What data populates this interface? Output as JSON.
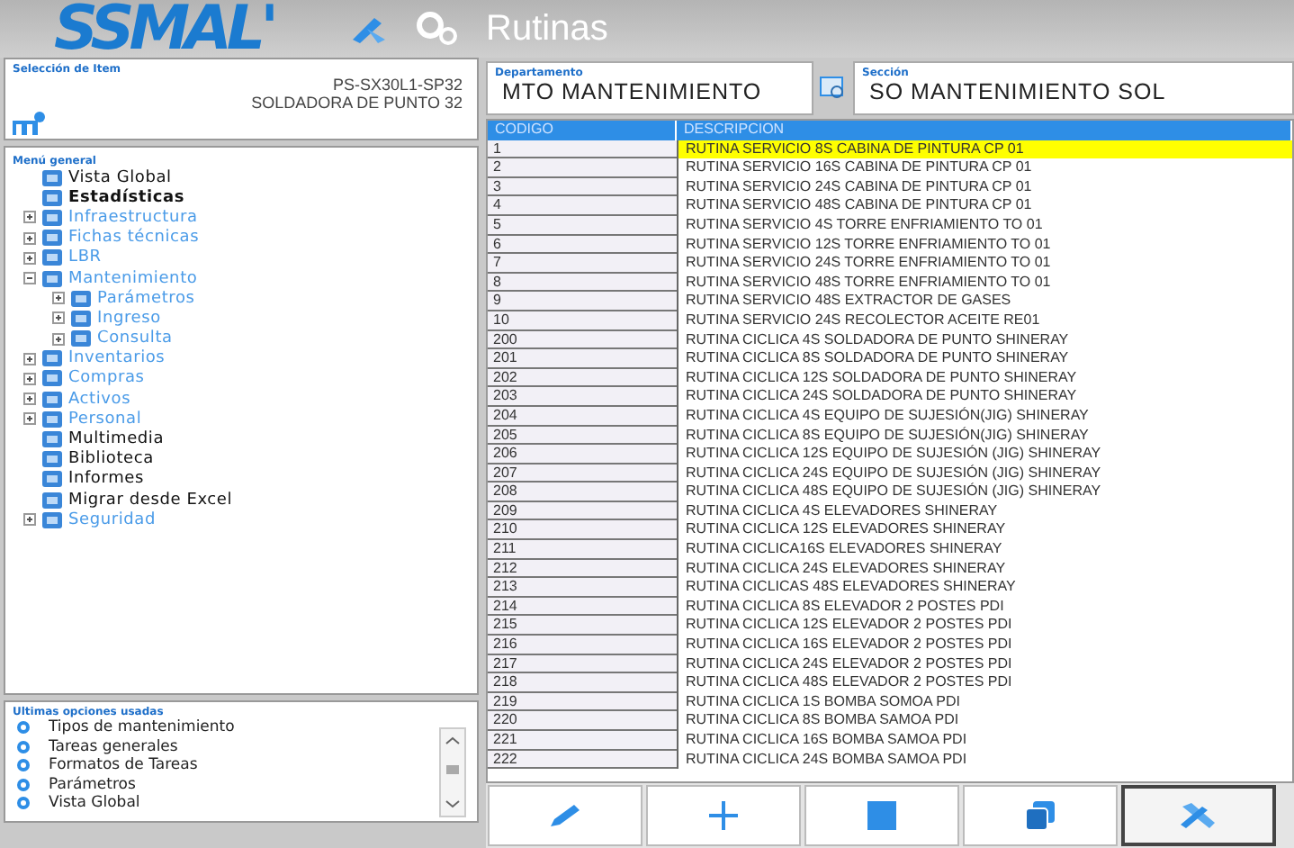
{
  "header": {
    "logo": "SSMAL'",
    "title": "Rutinas"
  },
  "selection": {
    "label": "Selección de Item",
    "code": "PS-SX30L1-SP32",
    "name": "SOLDADORA DE PUNTO 32"
  },
  "menu": {
    "label": "Menú general",
    "items": [
      {
        "label": "Vista Global",
        "kind": "plain"
      },
      {
        "label": "Estadísticas",
        "kind": "bold"
      },
      {
        "label": "Infraestructura",
        "kind": "link",
        "expanded": false
      },
      {
        "label": "Fichas técnicas",
        "kind": "link",
        "expanded": false
      },
      {
        "label": "LBR",
        "kind": "link",
        "expanded": false
      },
      {
        "label": "Mantenimiento",
        "kind": "link",
        "expanded": true,
        "children": [
          {
            "label": "Parámetros",
            "kind": "link",
            "expanded": false
          },
          {
            "label": "Ingreso",
            "kind": "link",
            "expanded": false
          },
          {
            "label": "Consulta",
            "kind": "link",
            "expanded": false
          }
        ]
      },
      {
        "label": "Inventarios",
        "kind": "link",
        "expanded": false
      },
      {
        "label": "Compras",
        "kind": "link",
        "expanded": false
      },
      {
        "label": "Activos",
        "kind": "link",
        "expanded": false
      },
      {
        "label": "Personal",
        "kind": "link",
        "expanded": false
      },
      {
        "label": "Multimedia",
        "kind": "plain"
      },
      {
        "label": "Biblioteca",
        "kind": "plain"
      },
      {
        "label": "Informes",
        "kind": "plain"
      },
      {
        "label": "Migrar desde Excel",
        "kind": "plain"
      },
      {
        "label": "Seguridad",
        "kind": "link",
        "expanded": false
      }
    ]
  },
  "recent": {
    "label": "Ultimas opciones usadas",
    "items": [
      "Tipos de mantenimiento",
      "Tareas generales",
      "Formatos de Tareas",
      "Parámetros",
      "Vista Global"
    ]
  },
  "department": {
    "label": "Departamento",
    "value": "MTO MANTENIMIENTO"
  },
  "section": {
    "label": "Sección",
    "value": "SO MANTENIMIENTO SOL"
  },
  "table": {
    "columns": [
      "CODIGO",
      "DESCRIPCION"
    ],
    "rows": [
      {
        "code": "1",
        "description": "RUTINA SERVICIO 8S CABINA DE PINTURA CP 01",
        "selected": true
      },
      {
        "code": "2",
        "description": "RUTINA SERVICIO 16S CABINA DE PINTURA CP 01",
        "selected": false
      },
      {
        "code": "3",
        "description": "RUTINA SERVICIO 24S CABINA DE PINTURA CP 01",
        "selected": false
      },
      {
        "code": "4",
        "description": "RUTINA SERVICIO 48S CABINA DE PINTURA CP 01",
        "selected": false
      },
      {
        "code": "5",
        "description": "RUTINA SERVICIO 4S TORRE ENFRIAMIENTO TO 01",
        "selected": false
      },
      {
        "code": "6",
        "description": "RUTINA SERVICIO 12S TORRE ENFRIAMIENTO TO 01",
        "selected": false
      },
      {
        "code": "7",
        "description": "RUTINA SERVICIO 24S TORRE ENFRIAMIENTO TO 01",
        "selected": false
      },
      {
        "code": "8",
        "description": "RUTINA SERVICIO 48S TORRE ENFRIAMIENTO TO 01",
        "selected": false
      },
      {
        "code": "9",
        "description": "RUTINA SERVICIO 48S EXTRACTOR DE GASES",
        "selected": false
      },
      {
        "code": "10",
        "description": "RUTINA SERVICIO 24S RECOLECTOR ACEITE RE01",
        "selected": false
      },
      {
        "code": "200",
        "description": "RUTINA CICLICA 4S SOLDADORA DE PUNTO SHINERAY",
        "selected": false
      },
      {
        "code": "201",
        "description": "RUTINA CICLICA 8S SOLDADORA DE PUNTO SHINERAY",
        "selected": false
      },
      {
        "code": "202",
        "description": "RUTINA CICLICA 12S SOLDADORA DE PUNTO SHINERAY",
        "selected": false
      },
      {
        "code": "203",
        "description": "RUTINA CICLICA 24S SOLDADORA DE PUNTO SHINERAY",
        "selected": false
      },
      {
        "code": "204",
        "description": "RUTINA CICLICA 4S EQUIPO DE SUJESIÓN(JIG) SHINERAY",
        "selected": false
      },
      {
        "code": "205",
        "description": "RUTINA CICLICA 8S EQUIPO DE SUJESIÓN(JIG) SHINERAY",
        "selected": false
      },
      {
        "code": "206",
        "description": "RUTINA CICLICA 12S EQUIPO DE SUJESIÓN (JIG) SHINERAY",
        "selected": false
      },
      {
        "code": "207",
        "description": "RUTINA CICLICA 24S EQUIPO DE SUJESIÓN (JIG) SHINERAY",
        "selected": false
      },
      {
        "code": "208",
        "description": "RUTINA CICLICA 48S EQUIPO DE SUJESIÓN (JIG) SHINERAY",
        "selected": false
      },
      {
        "code": "209",
        "description": "RUTINA CICLICA 4S ELEVADORES SHINERAY",
        "selected": false
      },
      {
        "code": "210",
        "description": "RUTINA CICLICA 12S ELEVADORES SHINERAY",
        "selected": false
      },
      {
        "code": "211",
        "description": "RUTINA CICLICA16S ELEVADORES SHINERAY",
        "selected": false
      },
      {
        "code": "212",
        "description": "RUTINA CICLICA 24S ELEVADORES SHINERAY",
        "selected": false
      },
      {
        "code": "213",
        "description": "RUTINA CICLICAS 48S ELEVADORES SHINERAY",
        "selected": false
      },
      {
        "code": "214",
        "description": "RUTINA CICLICA 8S ELEVADOR 2 POSTES PDI",
        "selected": false
      },
      {
        "code": "215",
        "description": "RUTINA CICLICA 12S ELEVADOR 2 POSTES  PDI",
        "selected": false
      },
      {
        "code": "216",
        "description": "RUTINA CICLICA 16S ELEVADOR 2 POSTES PDI",
        "selected": false
      },
      {
        "code": "217",
        "description": "RUTINA CICLICA 24S ELEVADOR 2 POSTES PDI",
        "selected": false
      },
      {
        "code": "218",
        "description": "RUTINA CICLICA 48S ELEVADOR 2 POSTES PDI",
        "selected": false
      },
      {
        "code": "219",
        "description": "RUTINA CICLICA 1S BOMBA SOMOA PDI",
        "selected": false
      },
      {
        "code": "220",
        "description": "RUTINA CICLICA 8S BOMBA SAMOA PDI",
        "selected": false
      },
      {
        "code": "221",
        "description": "RUTINA CICLICA 16S BOMBA SAMOA PDI",
        "selected": false
      },
      {
        "code": "222",
        "description": "RUTINA CICLICA 24S BOMBA SAMOA PDI",
        "selected": false
      }
    ]
  },
  "toolbar": [
    {
      "kind": "edit",
      "selected": false
    },
    {
      "kind": "add",
      "selected": false
    },
    {
      "kind": "delete",
      "selected": false
    },
    {
      "kind": "copy",
      "selected": false
    },
    {
      "kind": "tools",
      "selected": true
    }
  ]
}
